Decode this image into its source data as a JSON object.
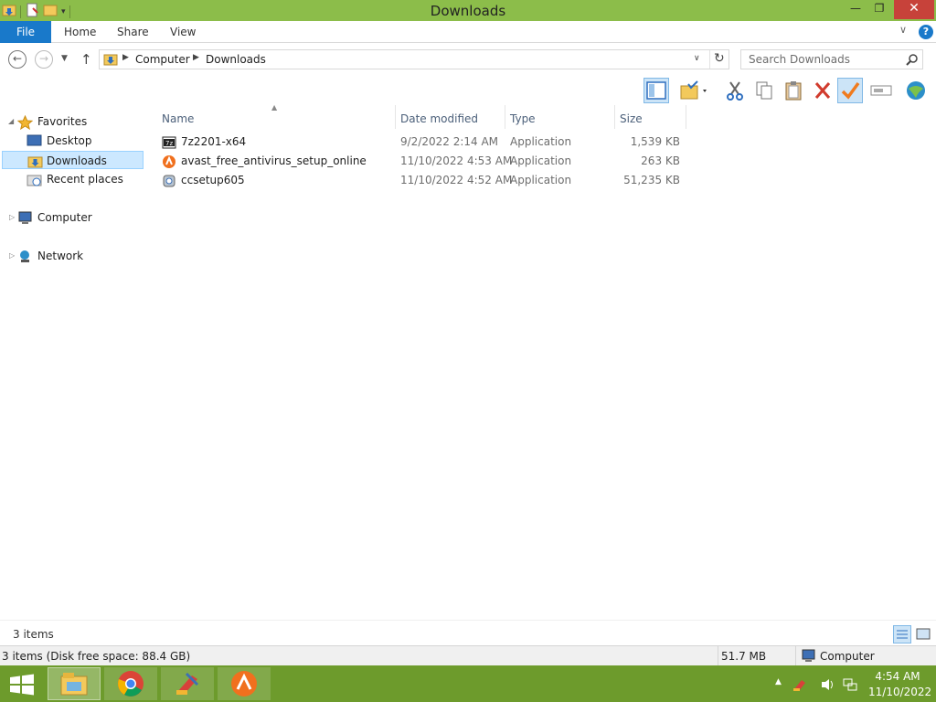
{
  "window": {
    "title": "Downloads",
    "controls": {
      "minimize": "—",
      "restore": "❐",
      "close": "✕"
    }
  },
  "ribbon": {
    "tabs": [
      {
        "label": "File"
      },
      {
        "label": "Home"
      },
      {
        "label": "Share"
      },
      {
        "label": "View"
      }
    ],
    "help": "?"
  },
  "navigation": {
    "breadcrumb": [
      "Computer",
      "Downloads"
    ],
    "search_placeholder": "Search Downloads"
  },
  "nav_pane": {
    "favorites": "Favorites",
    "favorite_items": [
      "Desktop",
      "Downloads",
      "Recent places"
    ],
    "computer": "Computer",
    "network": "Network",
    "selected": "Downloads"
  },
  "file_list": {
    "columns": [
      "Name",
      "Date modified",
      "Type",
      "Size"
    ],
    "files": [
      {
        "name": "7z2201-x64",
        "date": "9/2/2022 2:14 AM",
        "type": "Application",
        "size": "1,539 KB",
        "icon": "7zip-icon"
      },
      {
        "name": "avast_free_antivirus_setup_online",
        "date": "11/10/2022 4:53 AM",
        "type": "Application",
        "size": "263 KB",
        "icon": "avast-icon"
      },
      {
        "name": "ccsetup605",
        "date": "11/10/2022 4:52 AM",
        "type": "Application",
        "size": "51,235 KB",
        "icon": "ccleaner-icon"
      }
    ]
  },
  "status": {
    "items_count": "3 items",
    "info_left": "3 items (Disk free space: 88.4 GB)",
    "info_size": "51.7 MB",
    "zone": "Computer"
  },
  "taskbar": {
    "time": "4:54 AM",
    "date": "11/10/2022"
  },
  "colors": {
    "titlebar": "#8cbd4a",
    "taskbar": "#6d9b2c",
    "file_tab": "#1979ca",
    "close_button": "#c7423a",
    "selection": "#cce8ff"
  }
}
